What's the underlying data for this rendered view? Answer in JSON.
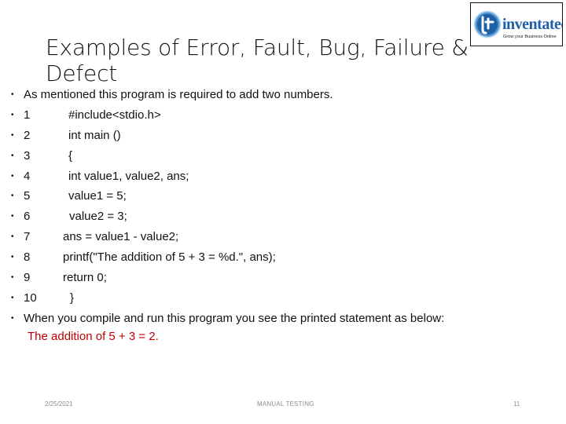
{
  "slide": {
    "title": "Examples of Error, Fault, Bug, Failure & Defect",
    "logo": {
      "icon": "inventateq-logo-icon",
      "brand": "inventateq",
      "tagline": "Grow your Business Online",
      "colors": {
        "brand_blue": "#1f5fa8",
        "tagline": "#222222"
      }
    },
    "intro": "As mentioned this program is required to add two numbers.",
    "code_lines": [
      {
        "num": "1",
        "code": "#include<stdio.h>"
      },
      {
        "num": "2",
        "code": "int main ()"
      },
      {
        "num": "3",
        "code": "{"
      },
      {
        "num": "4",
        "code": "int value1, value2, ans;"
      },
      {
        "num": "5",
        "code": "value1 = 5;"
      },
      {
        "num": "6",
        "code": "value2 = 3;"
      },
      {
        "num": "7",
        "code": "ans = value1 - value2;"
      },
      {
        "num": "8",
        "code": "printf(\"The addition of 5 + 3 = %d.\", ans);"
      },
      {
        "num": "9",
        "code": "return 0;"
      },
      {
        "num": "10",
        "code": "}"
      }
    ],
    "outro": "When you compile and run this program you see the printed statement as below:",
    "result": "The addition of 5 + 3 = 2.",
    "colors": {
      "result_text": "#c00000",
      "footer_text": "#8c8c8c"
    }
  },
  "footer": {
    "date": "2/25/2021",
    "center": "MANUAL TESTING",
    "page_number": "11"
  }
}
